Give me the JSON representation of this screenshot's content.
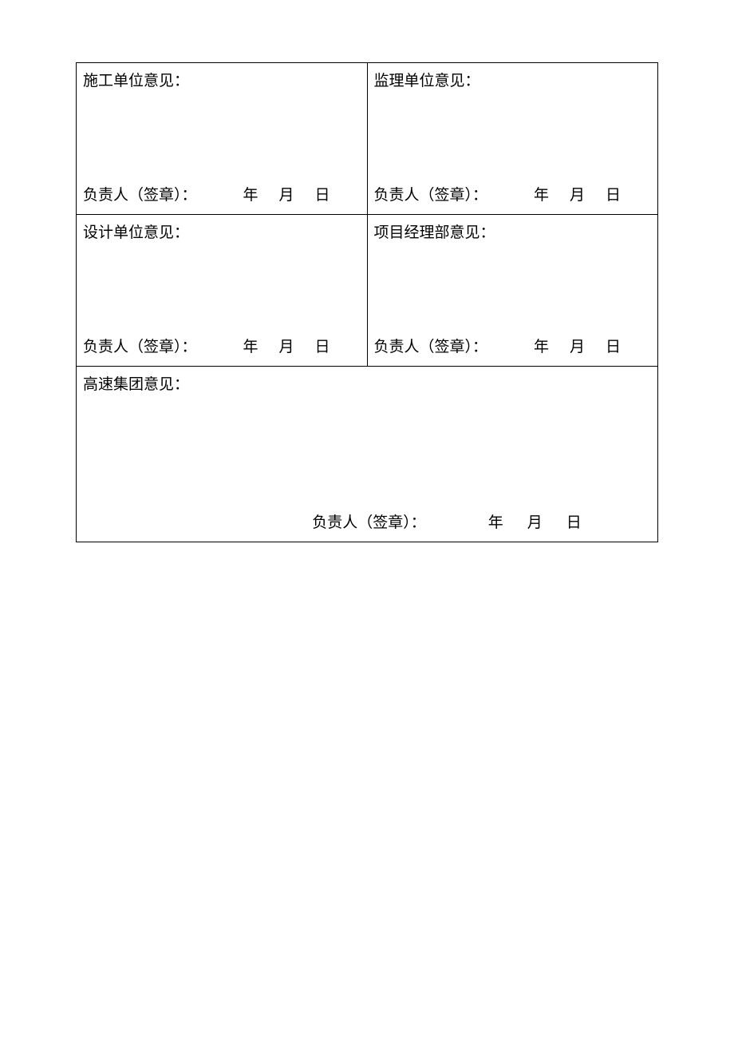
{
  "sections": {
    "construction": {
      "title": "施工单位意见：",
      "sign_label": "负责人（签章）：",
      "year": "年",
      "month": "月",
      "day": "日"
    },
    "supervision": {
      "title": "监理单位意见：",
      "sign_label": "负责人（签章）：",
      "year": "年",
      "month": "月",
      "day": "日"
    },
    "design": {
      "title": "设计单位意见：",
      "sign_label": "负责人（签章）：",
      "year": "年",
      "month": "月",
      "day": "日"
    },
    "project_mgr": {
      "title": "项目经理部意见：",
      "sign_label": "负责人（签章）：",
      "year": "年",
      "month": "月",
      "day": "日"
    },
    "expressway": {
      "title": "高速集团意见：",
      "sign_label": "负责人（签章）：",
      "year": "年",
      "month": "月",
      "day": "日"
    }
  }
}
